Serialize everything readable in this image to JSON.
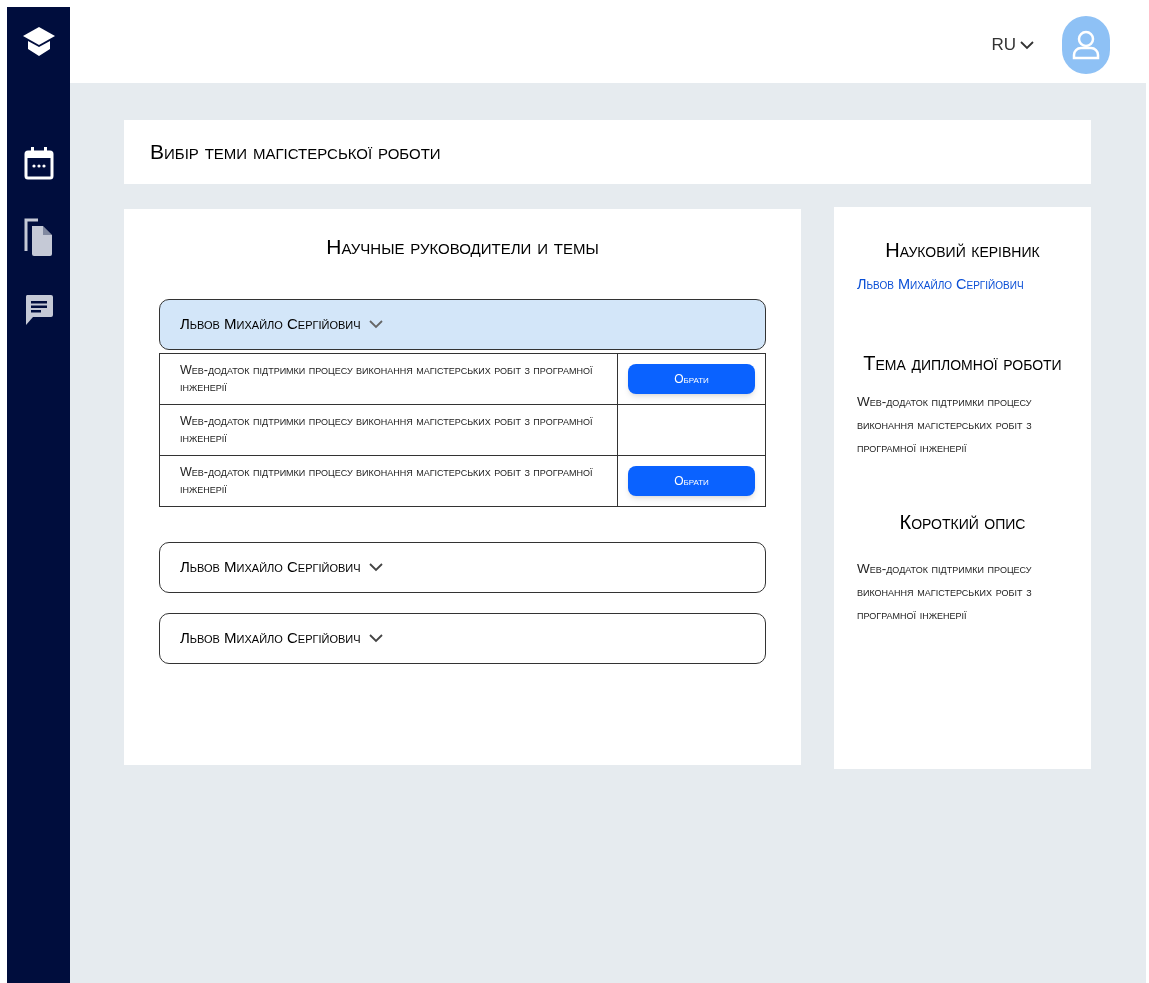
{
  "sidebar": {
    "items": [
      {
        "kind": "calendar",
        "selected": true
      },
      {
        "kind": "document",
        "selected": false
      },
      {
        "kind": "chat",
        "selected": false
      }
    ]
  },
  "header": {
    "language": "RU"
  },
  "page_title": "Вибір теми магістерської роботи",
  "supervisors_panel": {
    "title": "Научные руководители и темы",
    "supervisors": [
      {
        "name": "Львов Михайло Сергійович",
        "expanded": true,
        "topics": [
          {
            "title": "Web-додаток підтримки процесу виконання магістерських робіт з програмної інженерії",
            "button": "Обрати"
          },
          {
            "title": "Web-додаток підтримки процесу виконання магістерських робіт з програмної інженерії"
          },
          {
            "title": "Web-додаток підтримки процесу виконання магістерських робіт з програмної інженерії",
            "button": "Обрати"
          }
        ]
      },
      {
        "name": "Львов Михайло Сергійович",
        "expanded": false
      },
      {
        "name": "Львов Михайло Сергійович",
        "expanded": false
      }
    ]
  },
  "details": {
    "supervisor_heading": "Науковий керівник",
    "supervisor_name": "Львов Михайло Сергійович",
    "topic_heading": "Тема дипломної роботи",
    "topic": "Web-додаток підтримки процесу виконання магістерських робіт з програмної інженерії",
    "description_heading": "Короткий опис",
    "description": "Web-додаток підтримки процесу виконання магістерських робіт з програмної інженерії"
  }
}
